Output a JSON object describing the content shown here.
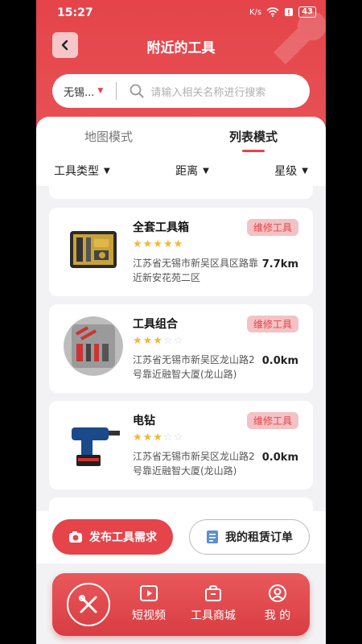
{
  "status": {
    "time": "15:27",
    "speed": "K/s",
    "battery": "43"
  },
  "header": {
    "title": "附近的工具"
  },
  "search": {
    "city": "无锡...",
    "placeholder": "请输入相关名称进行搜索"
  },
  "tabs": [
    {
      "label": "地图模式",
      "active": false
    },
    {
      "label": "列表模式",
      "active": true
    }
  ],
  "filters": [
    {
      "label": "工具类型"
    },
    {
      "label": "距离"
    },
    {
      "label": "星级"
    }
  ],
  "items": [
    {
      "name": "全套工具箱",
      "tag": "维修工具",
      "rating": 5,
      "address": "江苏省无锡市新吴区具区路靠近新安花苑二区",
      "distance": "7.7km",
      "icon": "toolbox-image"
    },
    {
      "name": "工具组合",
      "tag": "维修工具",
      "rating": 3,
      "address": "江苏省无锡市新吴区龙山路2号靠近融智大厦(龙山路)",
      "distance": "0.0km",
      "icon": "tool-set-image"
    },
    {
      "name": "电钻",
      "tag": "维修工具",
      "rating": 3,
      "address": "江苏省无锡市新吴区龙山路2号靠近融智大厦(龙山路)",
      "distance": "0.0km",
      "icon": "drill-image"
    }
  ],
  "actions": {
    "publish": "发布工具需求",
    "orders": "我的租赁订单"
  },
  "nav": {
    "video": "短视频",
    "mall": "工具商城",
    "mine": "我 的"
  },
  "colors": {
    "brand": "#e4444a",
    "star": "#f5b731",
    "tag_bg": "#f3c2c4"
  }
}
